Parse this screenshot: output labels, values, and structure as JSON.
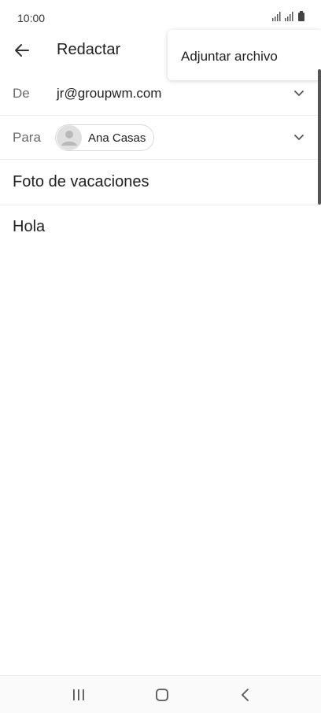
{
  "status_bar": {
    "time": "10:00",
    "icons": [
      "signal-icon",
      "signal-icon",
      "battery-icon"
    ]
  },
  "app_bar": {
    "back_icon": "arrow-left-icon",
    "title": "Redactar"
  },
  "overflow_menu": {
    "items": [
      {
        "label": "Adjuntar archivo"
      }
    ]
  },
  "compose": {
    "from": {
      "label": "De",
      "value": "jr@groupwm.com",
      "icon": "chevron-down-icon"
    },
    "to": {
      "label": "Para",
      "recipient": "Ana Casas",
      "icon": "chevron-down-icon",
      "avatar_icon": "person-icon"
    },
    "subject": "Foto de vacaciones",
    "body": "Hola"
  },
  "nav_bar": {
    "icons": [
      "recent-apps-icon",
      "home-icon",
      "back-nav-icon"
    ]
  },
  "colors": {
    "text": "#222222",
    "label": "#6b6b6b",
    "divider": "#ececec",
    "chip_border": "#d9d9d9"
  }
}
